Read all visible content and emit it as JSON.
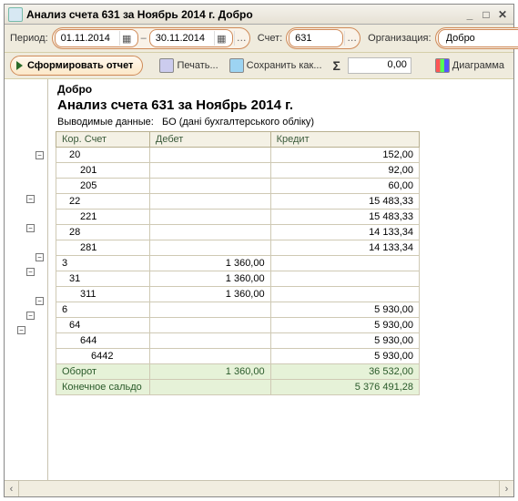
{
  "window": {
    "title": "Анализ счета 631 за Ноябрь 2014 г. Добро"
  },
  "labels": {
    "period": "Период:",
    "account": "Счет:",
    "org": "Организация:",
    "generate": "Сформировать отчет",
    "print": "Печать...",
    "save": "Сохранить как...",
    "sum": "0,00",
    "diagram": "Диаграмма"
  },
  "filters": {
    "date_from": "01.11.2014",
    "date_to": "30.11.2014",
    "account": "631",
    "org": "Добро"
  },
  "report_header": {
    "org": "Добро",
    "title": "Анализ счета 631 за Ноябрь 2014 г.",
    "subtitle_label": "Выводимые данные:",
    "subtitle_value": "БО (дані бухгалтерського обліку)"
  },
  "table": {
    "cols": [
      "Кор. Счет",
      "Дебет",
      "Кредит"
    ],
    "rows": [
      {
        "acct": "20",
        "indent": 1,
        "debit": "",
        "credit": "152,00"
      },
      {
        "acct": "201",
        "indent": 2,
        "debit": "",
        "credit": "92,00"
      },
      {
        "acct": "205",
        "indent": 2,
        "debit": "",
        "credit": "60,00"
      },
      {
        "acct": "22",
        "indent": 1,
        "debit": "",
        "credit": "15 483,33"
      },
      {
        "acct": "221",
        "indent": 2,
        "debit": "",
        "credit": "15 483,33"
      },
      {
        "acct": "28",
        "indent": 1,
        "debit": "",
        "credit": "14 133,34"
      },
      {
        "acct": "281",
        "indent": 2,
        "debit": "",
        "credit": "14 133,34"
      },
      {
        "acct": "3",
        "indent": 0,
        "debit": "1 360,00",
        "credit": ""
      },
      {
        "acct": "31",
        "indent": 1,
        "debit": "1 360,00",
        "credit": ""
      },
      {
        "acct": "311",
        "indent": 2,
        "debit": "1 360,00",
        "credit": ""
      },
      {
        "acct": "6",
        "indent": 0,
        "debit": "",
        "credit": "5 930,00"
      },
      {
        "acct": "64",
        "indent": 1,
        "debit": "",
        "credit": "5 930,00"
      },
      {
        "acct": "644",
        "indent": 2,
        "debit": "",
        "credit": "5 930,00"
      },
      {
        "acct": "6442",
        "indent": 3,
        "debit": "",
        "credit": "5 930,00"
      }
    ],
    "totals": [
      {
        "label": "Оборот",
        "debit": "1 360,00",
        "credit": "36 532,00"
      },
      {
        "label": "Конечное сальдо",
        "debit": "",
        "credit": "5 376 491,28"
      }
    ]
  },
  "chart_data": {
    "type": "table",
    "title": "Анализ счета 631 за Ноябрь 2014 г.",
    "columns": [
      "Кор. Счет",
      "Дебет",
      "Кредит"
    ],
    "rows": [
      [
        "20",
        "",
        152.0
      ],
      [
        "201",
        "",
        92.0
      ],
      [
        "205",
        "",
        60.0
      ],
      [
        "22",
        "",
        15483.33
      ],
      [
        "221",
        "",
        15483.33
      ],
      [
        "28",
        "",
        14133.34
      ],
      [
        "281",
        "",
        14133.34
      ],
      [
        "3",
        1360.0,
        ""
      ],
      [
        "31",
        1360.0,
        ""
      ],
      [
        "311",
        1360.0,
        ""
      ],
      [
        "6",
        "",
        5930.0
      ],
      [
        "64",
        "",
        5930.0
      ],
      [
        "644",
        "",
        5930.0
      ],
      [
        "6442",
        "",
        5930.0
      ],
      [
        "Оборот",
        1360.0,
        36532.0
      ],
      [
        "Конечное сальдо",
        "",
        5376491.28
      ]
    ]
  }
}
